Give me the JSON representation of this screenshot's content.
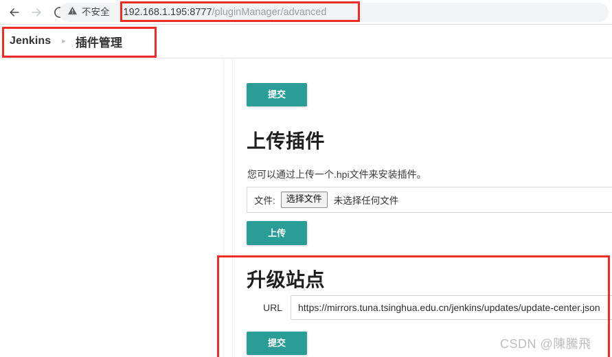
{
  "browser": {
    "back_icon": "arrow-left-icon",
    "forward_icon": "arrow-right-icon",
    "reload_icon": "reload-icon",
    "security_icon": "warning-triangle-icon",
    "security_label": "不安全",
    "url_host": "192.168.1.195:8777",
    "url_path": "/pluginManager/advanced",
    "url_full": "192.168.1.195:8777/pluginManager/advanced"
  },
  "breadcrumb": {
    "root_label": "Jenkins",
    "separator": "▸",
    "current_label": "插件管理"
  },
  "page": {
    "submit_top_label": "提交",
    "upload_section": {
      "heading": "上传插件",
      "help_text": "您可以通过上传一个.hpi文件来安装插件。",
      "file_label": "文件:",
      "choose_file_label": "选择文件",
      "no_file_label": "未选择任何文件",
      "upload_button_label": "上传"
    },
    "update_sites_section": {
      "heading": "升级站点",
      "url_label": "URL",
      "url_value": "https://mirrors.tuna.tsinghua.edu.cn/jenkins/updates/update-center.json",
      "url_placeholder": "",
      "submit_button_label": "提交"
    }
  },
  "watermark": {
    "text": "CSDN @陳騰飛"
  },
  "colors": {
    "accent_teal": "#2a9d96",
    "annotation_red": "#ee2b24",
    "omnibox_bg": "#f1f3f4"
  }
}
